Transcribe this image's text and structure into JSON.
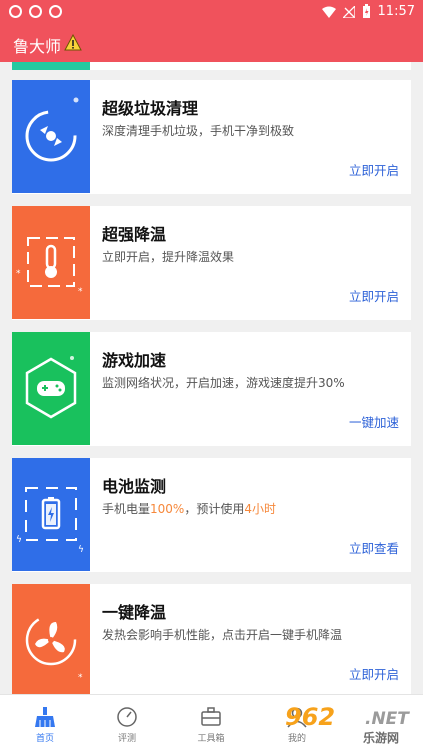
{
  "status_bar": {
    "time": "11:57"
  },
  "app": {
    "title": "鲁大师"
  },
  "cards": [
    {
      "title": "超级垃圾清理",
      "desc": "深度清理手机垃圾，手机干净到极致",
      "action": "立即开启",
      "color": "#2f6ee8",
      "icon": "cleanup-disk-icon"
    },
    {
      "title": "超强降温",
      "desc": "立即开启，提升降温效果",
      "action": "立即开启",
      "color": "#f56a3c",
      "icon": "thermometer-icon"
    },
    {
      "title": "游戏加速",
      "desc": "监测网络状况，开启加速，游戏速度提升30%",
      "action": "一键加速",
      "color": "#19c15d",
      "icon": "gamepad-icon"
    },
    {
      "title": "电池监测",
      "desc_prefix": "手机电量",
      "battery_level": "100%",
      "desc_middle": "，预计使用",
      "usage_time": "4小时",
      "action": "立即查看",
      "color": "#2f6ee8",
      "icon": "battery-icon"
    },
    {
      "title": "一键降温",
      "desc": "发热会影响手机性能，点击开启一键手机降温",
      "action": "立即开启",
      "color": "#f56a3c",
      "icon": "fan-icon"
    }
  ],
  "tabs": [
    {
      "label": "首页",
      "icon": "home-broom-icon",
      "active": true
    },
    {
      "label": "评测",
      "icon": "gauge-icon",
      "active": false
    },
    {
      "label": "工具箱",
      "icon": "toolbox-icon",
      "active": false
    },
    {
      "label": "我的",
      "icon": "profile-icon",
      "active": false
    }
  ],
  "watermark": {
    "brand": "962",
    "suffix": ".NET",
    "sub": "乐游网"
  },
  "colors": {
    "accent": "#f0525c",
    "link": "#2f63d8",
    "highlight": "#f6883b",
    "tab_active": "#3478f0"
  }
}
